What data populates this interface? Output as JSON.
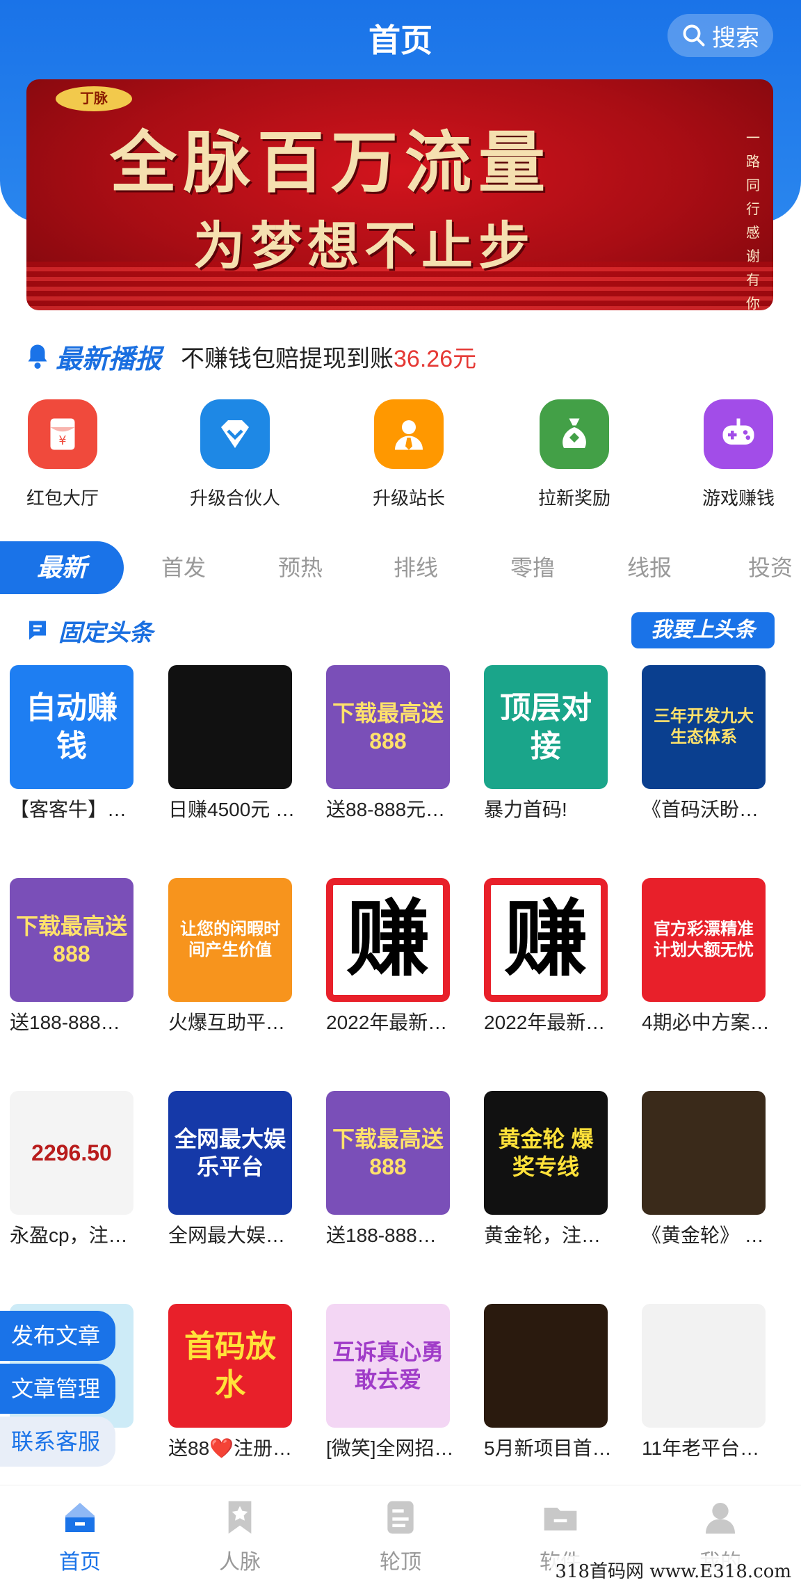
{
  "header": {
    "title": "首页",
    "search_label": "搜索"
  },
  "banner": {
    "logo": "丁脉",
    "line1": "全脉百万流量",
    "line2": "为梦想不止步",
    "side_text": "一路同行感谢有你"
  },
  "broadcast": {
    "title": "最新播报",
    "text": "不赚钱包赔提现到账",
    "amount": "36.26元"
  },
  "quick_menu": [
    {
      "label": "红包大厅",
      "icon": "red-packet-icon",
      "color": "#f04a3c"
    },
    {
      "label": "升级合伙人",
      "icon": "diamond-icon",
      "color": "#1e88e5"
    },
    {
      "label": "升级站长",
      "icon": "user-badge-icon",
      "color": "#ff9800"
    },
    {
      "label": "拉新奖励",
      "icon": "money-bag-icon",
      "color": "#43a047"
    },
    {
      "label": "游戏赚钱",
      "icon": "gamepad-icon",
      "color": "#a24de8"
    }
  ],
  "tabs": [
    "最新",
    "首发",
    "预热",
    "排线",
    "零撸",
    "线报",
    "投资"
  ],
  "section": {
    "title": "固定头条",
    "button": "我要上头条"
  },
  "cards": [
    {
      "caption": "【客客牛】…",
      "thumb_text": "自动赚钱",
      "bg": "#1e7ef2",
      "fg": "#ffffff"
    },
    {
      "caption": "日赚4500元 …",
      "thumb_text": "",
      "bg": "#111111",
      "fg": "#ffffff"
    },
    {
      "caption": "送88-888元…",
      "thumb_text": "下载最高送888",
      "bg": "#7a4fb8",
      "fg": "#ffe26b"
    },
    {
      "caption": "暴力首码!",
      "thumb_text": "顶层对接",
      "bg": "#1aa58a",
      "fg": "#ffffff"
    },
    {
      "caption": "《首码沃盼…",
      "thumb_text": "三年开发九大生态体系",
      "bg": "#0a3f8f",
      "fg": "#ffe26b"
    },
    {
      "caption": "送188-888…",
      "thumb_text": "下载最高送888",
      "bg": "#7a4fb8",
      "fg": "#ffe26b"
    },
    {
      "caption": "火爆互助平…",
      "thumb_text": "让您的闲暇时间产生价值",
      "bg": "#f7941d",
      "fg": "#ffffff"
    },
    {
      "caption": "2022年最新…",
      "thumb_text": "赚",
      "bg": "#e8202a",
      "fg": "#000000"
    },
    {
      "caption": "2022年最新…",
      "thumb_text": "赚",
      "bg": "#e8202a",
      "fg": "#000000"
    },
    {
      "caption": "4期必中方案…",
      "thumb_text": "官方彩漂精准计划大额无忧",
      "bg": "#e8202a",
      "fg": "#ffffff"
    },
    {
      "caption": "永盈cp，注…",
      "thumb_text": "2296.50",
      "bg": "#f4f4f4",
      "fg": "#b81c1c"
    },
    {
      "caption": "全网最大娱…",
      "thumb_text": "全网最大娱乐平台",
      "bg": "#1539a8",
      "fg": "#ffffff"
    },
    {
      "caption": "送188-888…",
      "thumb_text": "下载最高送888",
      "bg": "#7a4fb8",
      "fg": "#ffe26b"
    },
    {
      "caption": "黄金轮，注…",
      "thumb_text": "黄金轮 爆奖专线",
      "bg": "#111111",
      "fg": "#ffe23a"
    },
    {
      "caption": "《黄金轮》 …",
      "thumb_text": "",
      "bg": "#3a2a1a",
      "fg": "#ffffff"
    },
    {
      "caption": "…",
      "thumb_text": "",
      "bg": "#cdebf7",
      "fg": "#1a73e8"
    },
    {
      "caption": "送88❤️注册…",
      "thumb_text": "首码放水",
      "bg": "#e8202a",
      "fg": "#ffe23a"
    },
    {
      "caption": "[微笑]全网招…",
      "thumb_text": "互诉真心勇敢去爱",
      "bg": "#f3d6f4",
      "fg": "#a03cc8"
    },
    {
      "caption": "5月新项目首…",
      "thumb_text": "",
      "bg": "#2a1a0e",
      "fg": "#f5c26b"
    },
    {
      "caption": "11年老平台…",
      "thumb_text": "",
      "bg": "#f2f2f2",
      "fg": "#333333"
    }
  ],
  "float_menu": [
    "发布文章",
    "文章管理",
    "联系客服"
  ],
  "bottom_nav": [
    {
      "label": "首页",
      "icon": "home-icon",
      "active": true
    },
    {
      "label": "人脉",
      "icon": "star-bookmark-icon",
      "active": false
    },
    {
      "label": "轮顶",
      "icon": "document-icon",
      "active": false
    },
    {
      "label": "软件",
      "icon": "folder-icon",
      "active": false
    },
    {
      "label": "我的",
      "icon": "profile-icon",
      "active": false
    }
  ],
  "watermark": "318首码网 www.E318.com",
  "colors": {
    "primary": "#1a73e8",
    "amount": "#e53935"
  }
}
